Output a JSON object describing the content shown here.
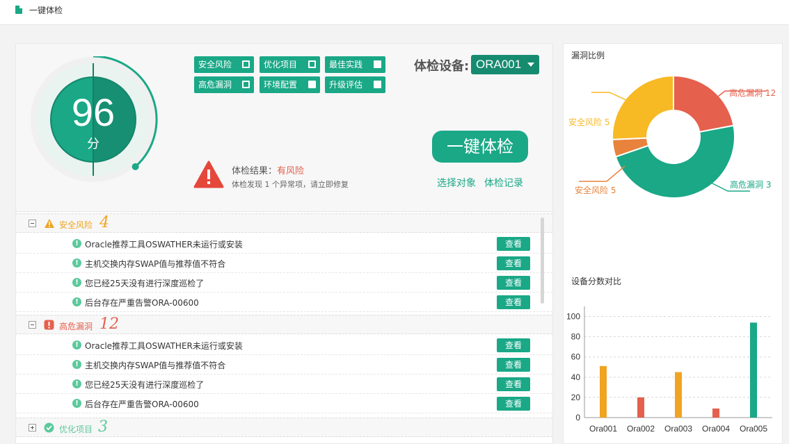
{
  "topbar": {
    "title": "一键体检",
    "icon": "document-icon"
  },
  "score": {
    "value": "96",
    "unit": "分",
    "fill_fraction": 0.96,
    "color": "#1aa887"
  },
  "filters": [
    {
      "label": "安全风险",
      "checked": false
    },
    {
      "label": "优化项目",
      "checked": false
    },
    {
      "label": "最佳实践",
      "checked": true
    },
    {
      "label": "高危漏洞",
      "checked": false
    },
    {
      "label": "环境配置",
      "checked": true
    },
    {
      "label": "升级评估",
      "checked": true
    }
  ],
  "device": {
    "label": "体检设备:",
    "selected": "ORA001"
  },
  "actions": {
    "check_button": "一键体检",
    "select_target": "选择对象",
    "check_record": "体检记录"
  },
  "result": {
    "prefix": "体检结果：",
    "status": "有风险",
    "detail": "体检发现 1 个异常项，请立即修复"
  },
  "groups": [
    {
      "label": "安全风险",
      "count": "4",
      "color": "#f0a422",
      "icon": "warning-icon",
      "expanded": true,
      "items": [
        {
          "text": "Oracle推荐工具OSWATHER未运行或安装",
          "button": "查看"
        },
        {
          "text": "主机交换内存SWAP值与推荐值不符合",
          "button": "查看"
        },
        {
          "text": "您已经25天没有进行深度巡检了",
          "button": "查看"
        },
        {
          "text": "后台存在严重告警ORA-00600",
          "button": "查看"
        }
      ]
    },
    {
      "label": "高危漏洞",
      "count": "12",
      "color": "#e5604d",
      "icon": "alert-icon",
      "expanded": true,
      "items": [
        {
          "text": "Oracle推荐工具OSWATHER未运行或安装",
          "button": "查看"
        },
        {
          "text": "主机交换内存SWAP值与推荐值不符合",
          "button": "查看"
        },
        {
          "text": "您已经25天没有进行深度巡检了",
          "button": "查看"
        },
        {
          "text": "后台存在严重告警ORA-00600",
          "button": "查看"
        }
      ]
    },
    {
      "label": "优化项目",
      "count": "3",
      "color": "#5cc99c",
      "icon": "check-circle-icon",
      "expanded": false,
      "items": []
    }
  ],
  "donut_panel": {
    "title": "漏洞比例",
    "labels": [
      {
        "text": "高危漏洞 12",
        "color": "#e5604d"
      },
      {
        "text": "安全风险 5",
        "color": "#f7b924"
      },
      {
        "text": "安全风险 5",
        "color": "#e8823c"
      },
      {
        "text": "高危漏洞 3",
        "color": "#1aa887"
      }
    ]
  },
  "bar_panel": {
    "title": "设备分数对比"
  },
  "chart_data": [
    {
      "type": "pie",
      "title": "漏洞比例",
      "slices": [
        {
          "label": "高危漏洞 12",
          "value": 12,
          "color": "#e5604d"
        },
        {
          "label": "高危漏洞 3",
          "value": 26,
          "color": "#1aa887"
        },
        {
          "label": "安全风险 5",
          "value": 2.5,
          "color": "#e8823c"
        },
        {
          "label": "安全风险 5",
          "value": 14,
          "color": "#f7b924"
        }
      ]
    },
    {
      "type": "bar",
      "title": "设备分数对比",
      "categories": [
        "Ora001",
        "Ora002",
        "Ora003",
        "Ora004",
        "Ora005"
      ],
      "values": [
        51,
        20,
        45,
        9,
        94
      ],
      "colors": [
        "#f0a422",
        "#e5604d",
        "#f0a422",
        "#e5604d",
        "#1aa887"
      ],
      "yticks": [
        0,
        20,
        40,
        60,
        80,
        100
      ],
      "ylim": [
        0,
        110
      ],
      "grid": true
    }
  ]
}
